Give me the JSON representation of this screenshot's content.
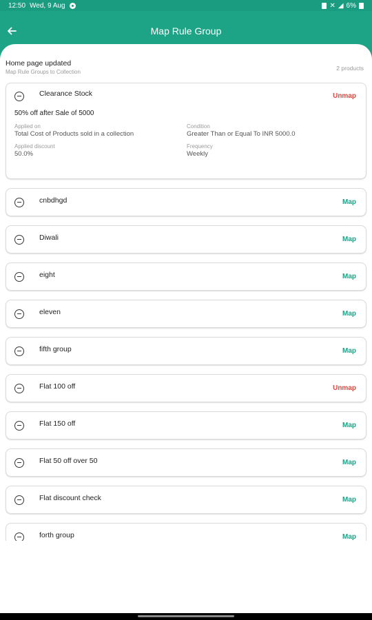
{
  "status_bar": {
    "time": "12:50",
    "date": "Wed, 9 Aug",
    "battery": "6%"
  },
  "app_bar": {
    "title": "Map Rule Group"
  },
  "header": {
    "title": "Home page updated",
    "subtitle": "Map Rule Groups to Collection",
    "count": "2 products"
  },
  "expanded_group": {
    "name": "Clearance Stock",
    "action": "Unmap",
    "offer": "50% off after Sale of 5000",
    "applied_on_label": "Applied on",
    "applied_on_value": "Total Cost of Products sold in a collection",
    "condition_label": "Condition",
    "condition_value": "Greater Than or Equal To INR 5000.0",
    "discount_label": "Applied discount",
    "discount_value": "50.0%",
    "frequency_label": "Frequency",
    "frequency_value": "Weekly"
  },
  "groups": [
    {
      "name": "cnbdhgd",
      "action": "Map"
    },
    {
      "name": "Diwali",
      "action": "Map"
    },
    {
      "name": "eight",
      "action": "Map"
    },
    {
      "name": "eleven",
      "action": "Map"
    },
    {
      "name": "fifth group",
      "action": "Map"
    },
    {
      "name": "Flat 100 off",
      "action": "Unmap"
    },
    {
      "name": "Flat 150 off",
      "action": "Map"
    },
    {
      "name": "Flat 50 off over 50",
      "action": "Map"
    },
    {
      "name": "Flat discount check",
      "action": "Map"
    },
    {
      "name": "forth group",
      "action": "Map"
    }
  ],
  "colors": {
    "primary": "#1da486",
    "unmap": "#e0473e"
  }
}
